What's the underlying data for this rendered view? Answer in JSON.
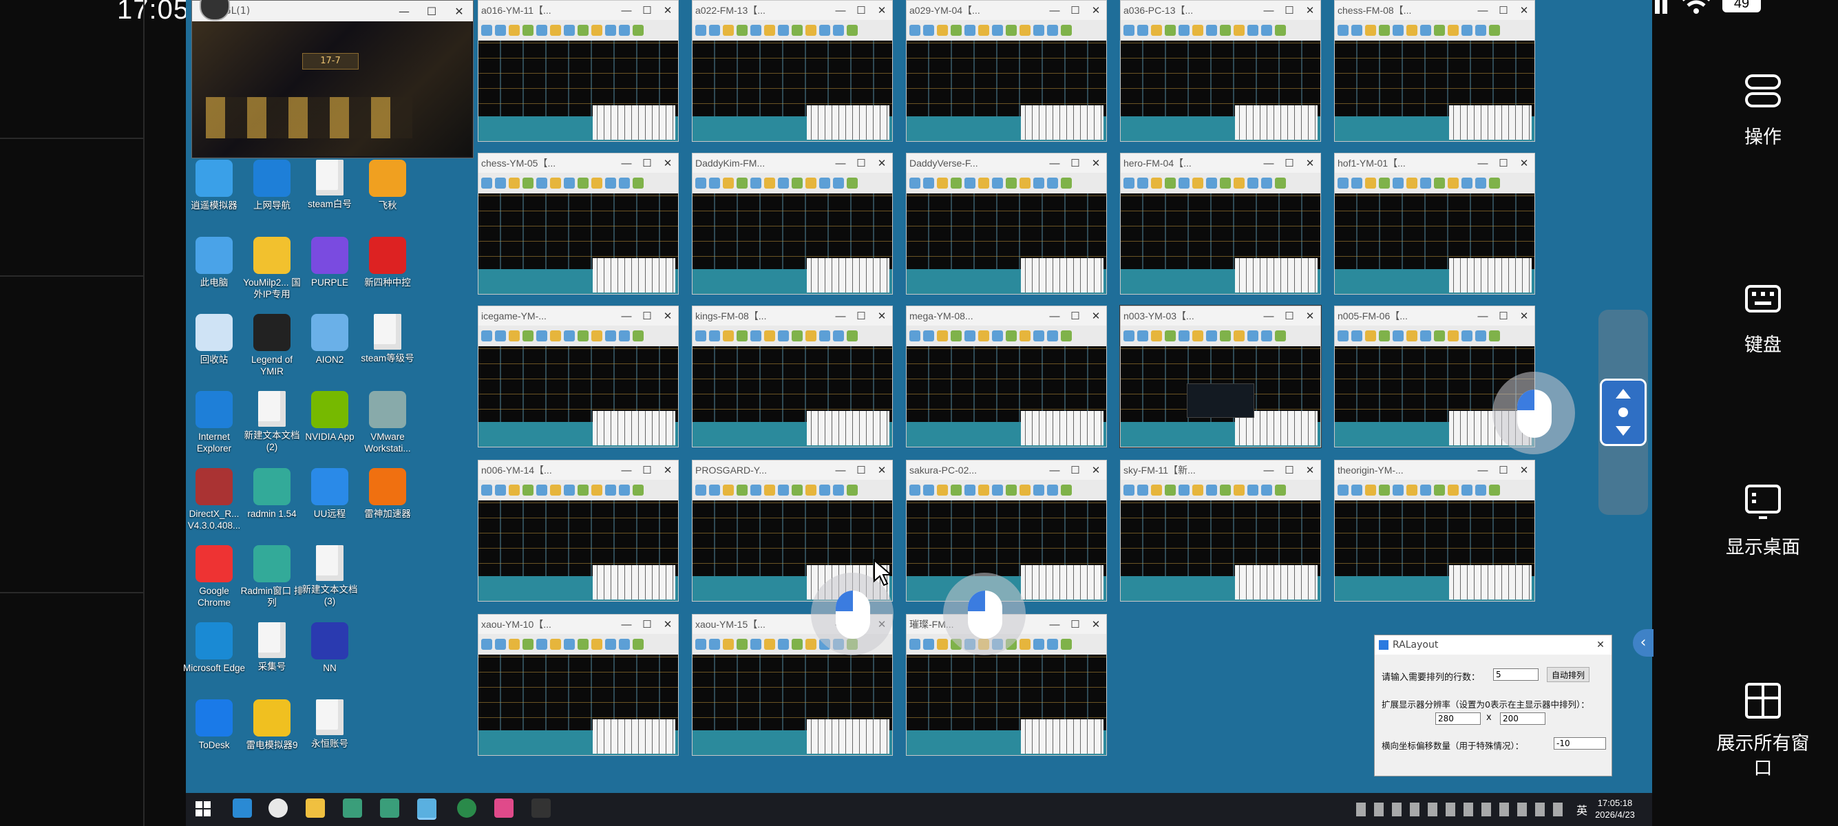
{
  "phone_status": {
    "time": "17:05",
    "battery": "49"
  },
  "game_window": {
    "title": "rGL(1)",
    "level": "17-7"
  },
  "remote_windows": [
    {
      "title": "a016-YM-11【..."
    },
    {
      "title": "a022-FM-13【..."
    },
    {
      "title": "a029-YM-04【..."
    },
    {
      "title": "a036-PC-13【..."
    },
    {
      "title": "chess-FM-08【..."
    },
    {
      "title": "chess-YM-05【..."
    },
    {
      "title": "DaddyKim-FM..."
    },
    {
      "title": "DaddyVerse-F..."
    },
    {
      "title": "hero-FM-04【..."
    },
    {
      "title": "hof1-YM-01【..."
    },
    {
      "title": "icegame-YM-..."
    },
    {
      "title": "kings-FM-08【..."
    },
    {
      "title": "mega-YM-08..."
    },
    {
      "title": "n003-YM-03【..."
    },
    {
      "title": "n005-FM-06【..."
    },
    {
      "title": "n006-YM-14【..."
    },
    {
      "title": "PROSGARD-Y..."
    },
    {
      "title": "sakura-PC-02..."
    },
    {
      "title": "sky-FM-11【新..."
    },
    {
      "title": "theorigin-YM-..."
    },
    {
      "title": "xaou-YM-10【..."
    },
    {
      "title": "xaou-YM-15【..."
    },
    {
      "title": "璀璨-FM..."
    }
  ],
  "desktop_icons": [
    {
      "label": "逍遥模拟器",
      "icon": "emulator-icon",
      "color": "#3aa0e8"
    },
    {
      "label": "上网导航",
      "icon": "ie-icon",
      "color": "#1e7fd8"
    },
    {
      "label": "steam白号",
      "icon": "text-file-icon",
      "color": "#f5f5f5"
    },
    {
      "label": "飞秋",
      "icon": "feiqiu-icon",
      "color": "#f0a020"
    },
    {
      "label": "此电脑",
      "icon": "computer-icon",
      "color": "#4aa3e8"
    },
    {
      "label": "YouMilp2... 国外IP专用",
      "icon": "youmi-icon",
      "color": "#f2c12e"
    },
    {
      "label": "PURPLE",
      "icon": "purple-icon",
      "color": "#7a4be0"
    },
    {
      "label": "新四种中控",
      "icon": "s-control-icon",
      "color": "#d22"
    },
    {
      "label": "回收站",
      "icon": "recycle-bin-icon",
      "color": "#cfe3f5"
    },
    {
      "label": "Legend of YMIR",
      "icon": "ymir-icon",
      "color": "#222"
    },
    {
      "label": "AION2",
      "icon": "aion-icon",
      "color": "#6ab0e8"
    },
    {
      "label": "steam等级号",
      "icon": "text-file-icon",
      "color": "#f5f5f5"
    },
    {
      "label": "Internet Explorer",
      "icon": "ie-icon",
      "color": "#1e7fd8"
    },
    {
      "label": "新建文本文档 (2)",
      "icon": "text-file-icon",
      "color": "#f5f5f5"
    },
    {
      "label": "NVIDIA App",
      "icon": "nvidia-icon",
      "color": "#76b900"
    },
    {
      "label": "VMware Workstati...",
      "icon": "vmware-icon",
      "color": "#8aa"
    },
    {
      "label": "DirectX_R... V4.3.0.408...",
      "icon": "winrar-icon",
      "color": "#a33"
    },
    {
      "label": "radmin 1.54",
      "icon": "radmin-icon",
      "color": "#3a9"
    },
    {
      "label": "UU远程",
      "icon": "uu-icon",
      "color": "#2a8ae8"
    },
    {
      "label": "雷神加速器",
      "icon": "leishen-icon",
      "color": "#f07010"
    },
    {
      "label": "Google Chrome",
      "icon": "chrome-icon",
      "color": "#e33"
    },
    {
      "label": "Radmin窗口 排列",
      "icon": "radmin-icon",
      "color": "#3a9"
    },
    {
      "label": "新建文本文档 (3)",
      "icon": "text-file-icon",
      "color": "#f5f5f5"
    },
    {
      "label": "",
      "icon": "",
      "color": ""
    },
    {
      "label": "Microsoft Edge",
      "icon": "edge-icon",
      "color": "#1a8ad4"
    },
    {
      "label": "采集号",
      "icon": "text-file-icon",
      "color": "#f5f5f5"
    },
    {
      "label": "NN",
      "icon": "nn-icon",
      "color": "#2a3ab0"
    },
    {
      "label": "",
      "icon": "",
      "color": ""
    },
    {
      "label": "ToDesk",
      "icon": "todesk-icon",
      "color": "#1a7ae8"
    },
    {
      "label": "雷电模拟器9",
      "icon": "ldplayer-icon",
      "color": "#f0c020"
    },
    {
      "label": "永恒账号",
      "icon": "text-file-icon",
      "color": "#f5f5f5"
    }
  ],
  "ralayout": {
    "title": "RALayout",
    "rows_label": "请输入需要排列的行数：",
    "rows_value": "5",
    "auto_button": "自动排列",
    "ext_label": "扩展显示器分辨率（设置为0表示在主显示器中排列）：",
    "width_value": "280",
    "x_sep": "x",
    "height_value": "200",
    "offset_label": "横向坐标偏移数量（用于特殊情况）：",
    "offset_value": "-10"
  },
  "taskbar": {
    "time": "17:05:18",
    "date": "2026/4/23",
    "ime": "英"
  },
  "right_controls": {
    "operate": "操作",
    "keyboard": "键盘",
    "show_desktop": "显示桌面",
    "show_all": "展示所有窗口"
  }
}
